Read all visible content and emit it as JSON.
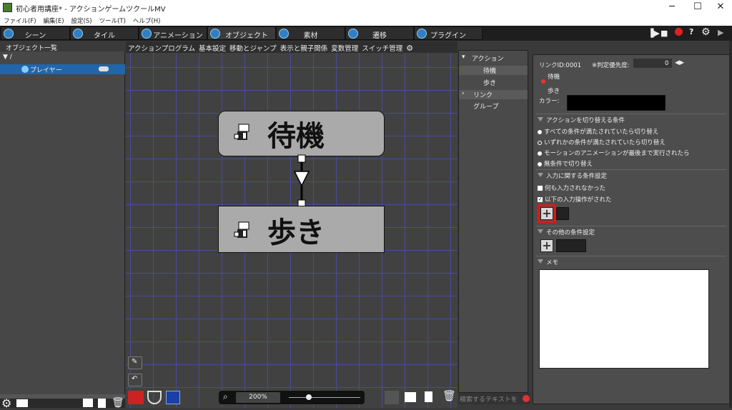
{
  "window": {
    "title": "初心者用講座* - アクションゲームツクールMV",
    "min": "─",
    "max": "☐",
    "close": "✕"
  },
  "menu": [
    "ファイル(F)",
    "編集(E)",
    "設定(S)",
    "ツール(T)",
    "ヘルプ(H)"
  ],
  "tabs": [
    "シーン",
    "タイル",
    "アニメーション",
    "オブジェクト",
    "素材",
    "遷移",
    "プラグイン"
  ],
  "left_panel": {
    "header": "オブジェクト一覧",
    "root": "▼ /",
    "item": "プレイヤー"
  },
  "canvas": {
    "tabs": [
      "アクションプログラム",
      "基本設定",
      "移動とジャンプ",
      "表示と親子関係",
      "変数管理",
      "スイッチ管理"
    ],
    "nodes": [
      "待機",
      "歩き"
    ],
    "zoom": "200%"
  },
  "action_tree": {
    "rows": [
      "アクション",
      "待機",
      "歩き",
      "リンク",
      "グループ"
    ],
    "search_placeholder": "検索するテキストを"
  },
  "right_panel": {
    "link_id": "リンクID:0001",
    "priority_label": "※判定優先度:",
    "priority_value": "0",
    "from": "待機",
    "to": "歩き",
    "color_label": "カラー:",
    "switch_section": "アクションを切り替える条件",
    "options": [
      "すべての条件が満たされていたら切り替え",
      "いずれかの条件が満たされていたら切り替え",
      "モーションのアニメーションが最後まで実行されたら",
      "無条件で切り替え"
    ],
    "input_section": "入力に関する条件設定",
    "checks": [
      "何も入力されなかった",
      "以下の入力操作がされた"
    ],
    "other_section": "その他の条件設定",
    "memo_section": "メモ"
  },
  "colors": {
    "tab_icon": "#2f7fc8",
    "selected": "#2266aa",
    "grid": "#4a4a9e",
    "highlight": "#e01818"
  }
}
